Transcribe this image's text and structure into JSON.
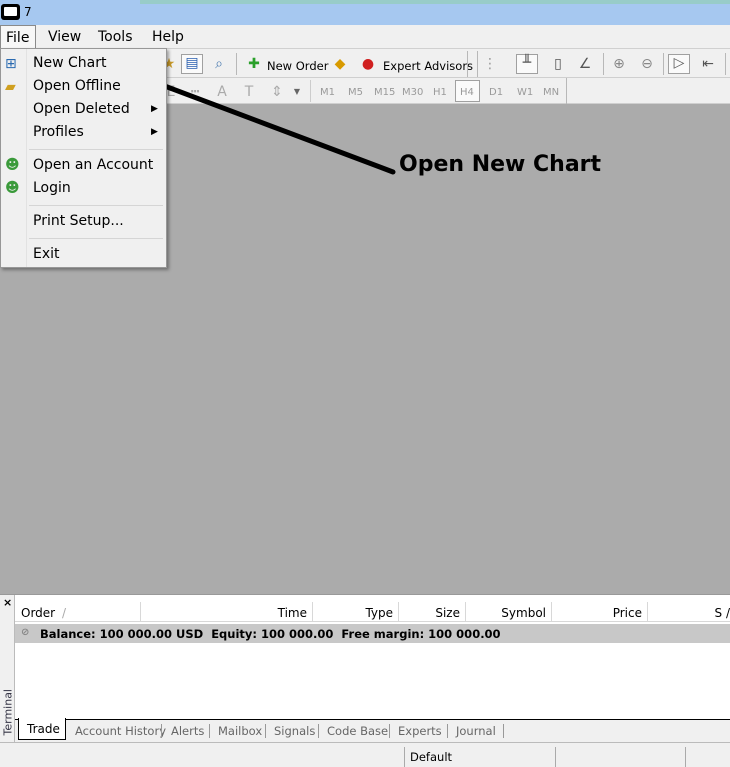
{
  "window": {
    "title": "7"
  },
  "menubar": {
    "items": [
      "File",
      "View",
      "Tools",
      "Help"
    ]
  },
  "toolbar": {
    "new_order": "New Order",
    "expert_advisors": "Expert Advisors",
    "timeframes": [
      "M1",
      "M5",
      "M15",
      "M30",
      "H1",
      "H4",
      "D1",
      "W1",
      "MN"
    ],
    "active_timeframe": "H4"
  },
  "file_menu": {
    "items": [
      {
        "label": "New Chart",
        "icon": "new-chart-icon"
      },
      {
        "label": "Open Offline",
        "icon": "folder-open-icon"
      },
      {
        "label": "Open Deleted",
        "submenu": true
      },
      {
        "label": "Profiles",
        "submenu": true
      },
      {
        "label": "Open an Account",
        "icon": "user-add-icon"
      },
      {
        "label": "Login",
        "icon": "user-login-icon"
      },
      {
        "label": "Print Setup..."
      },
      {
        "label": "Exit"
      }
    ]
  },
  "annotation": {
    "text": "Open New Chart"
  },
  "terminal": {
    "label": "Terminal",
    "close": "×",
    "columns": [
      "Order",
      "Time",
      "Type",
      "Size",
      "Symbol",
      "Price",
      "S /"
    ],
    "sort_indicator": "/",
    "balance_row": "Balance: 100 000.00 USD  Equity: 100 000.00  Free margin: 100 000.00",
    "tabs": [
      "Trade",
      "Account History",
      "Alerts",
      "Mailbox",
      "Signals",
      "Code Base",
      "Experts",
      "Journal"
    ],
    "active_tab": "Trade"
  },
  "statusbar": {
    "profile": "Default"
  }
}
